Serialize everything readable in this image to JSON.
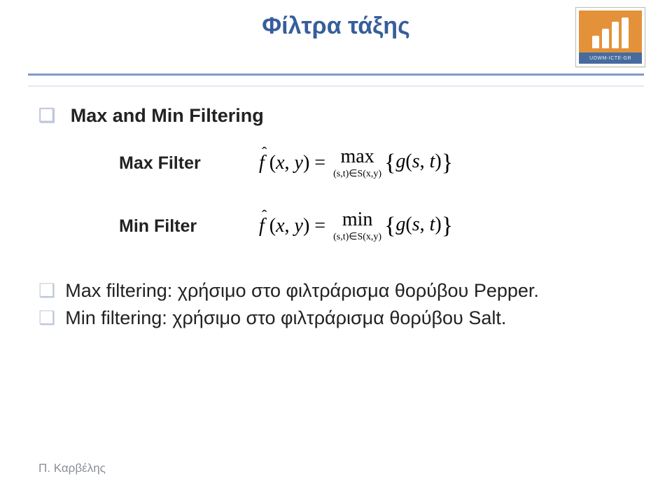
{
  "title": "Φίλτρα τάξης",
  "logo_text": "UOWM-ICTE-GR",
  "heading": "Max and Min Filtering",
  "max_filter": {
    "label": "Max Filter",
    "lhs": "f̂ (x, y) =",
    "op": "max",
    "sub": "(s,t)∈S(x,y)",
    "rhs": "g(s, t)"
  },
  "min_filter": {
    "label": "Min Filter",
    "lhs": "f̂ (x, y) =",
    "op": "min",
    "sub": "(s,t)∈S(x,y)",
    "rhs": "g(s, t)"
  },
  "bullets": [
    "Max filtering: χρήσιμο στο φιλτράρισμα θορύβου Pepper.",
    "Min filtering: χρήσιμο στο φιλτράρισμα θορύβου Salt."
  ],
  "footer": "Π. Καρβέλης",
  "chart_data": {
    "type": "table",
    "title": "Rank-order (max/min) filtering definitions",
    "rows": [
      {
        "filter": "Max Filter",
        "definition": "f̂(x,y) = max_{(s,t)∈S(x,y)} { g(s,t) }"
      },
      {
        "filter": "Min Filter",
        "definition": "f̂(x,y) = min_{(s,t)∈S(x,y)} { g(s,t) }"
      }
    ],
    "notes": [
      "Max filtering is useful for removing Pepper noise.",
      "Min filtering is useful for removing Salt noise."
    ]
  }
}
